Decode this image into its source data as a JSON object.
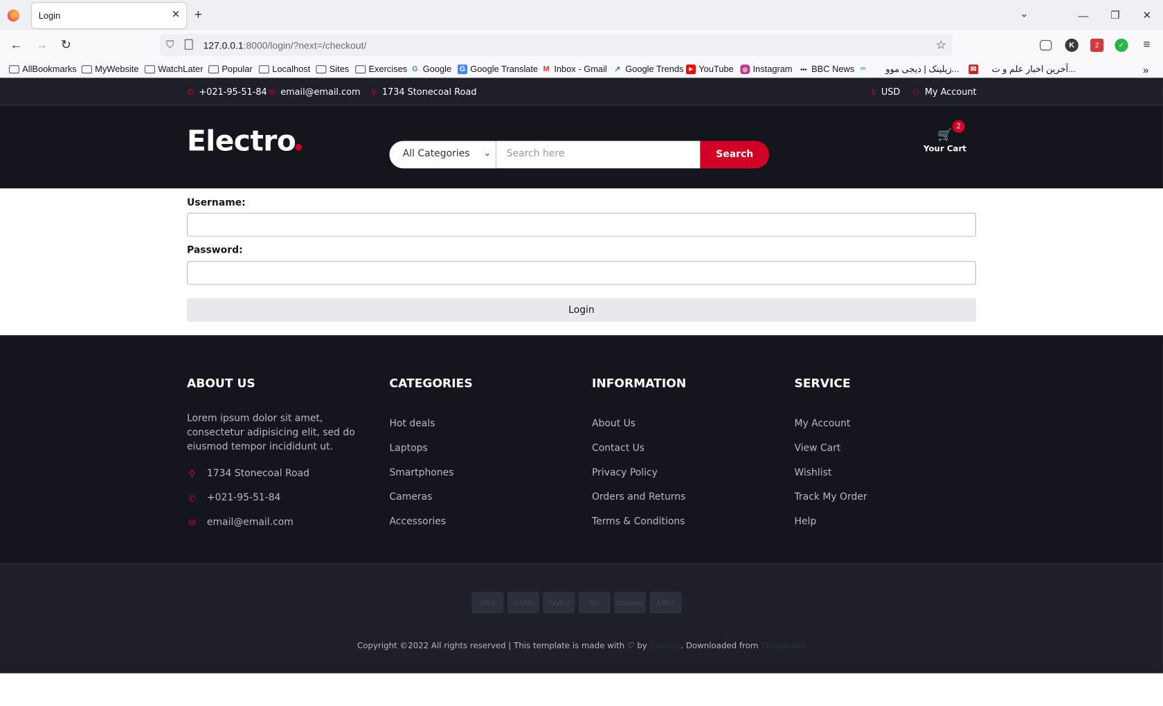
{
  "browser": {
    "tab_title": "Login",
    "url_host": "127.0.0.1",
    "url_rest": ":8000/login/?next=/checkout/",
    "bookmarks": [
      "AllBookmarks",
      "MyWebsite",
      "WatchLater",
      "Popular",
      "Localhost",
      "Sites",
      "Exercises",
      "Google",
      "Google Translate",
      "Inbox - Gmail",
      "Google Trends",
      "YouTube",
      "Instagram",
      "BBC News",
      "زیلینک | دیجی موو...",
      "آخرین اخبار علم و ت..."
    ],
    "ext_badge": "2"
  },
  "topbar": {
    "phone": "+021-95-51-84",
    "email": "email@email.com",
    "address": "1734 Stonecoal Road",
    "currency": "USD",
    "account": "My Account"
  },
  "header": {
    "logo": "Electro",
    "category_selected": "All Categories",
    "search_placeholder": "Search here",
    "search_button": "Search",
    "cart_label": "Your Cart",
    "cart_count": "2"
  },
  "form": {
    "username_label": "Username:",
    "password_label": "Password:",
    "login_button": "Login"
  },
  "footer": {
    "about_title": "ABOUT US",
    "about_text": "Lorem ipsum dolor sit amet, consectetur adipisicing elit, sed do eiusmod tempor incididunt ut.",
    "address": "1734 Stonecoal Road",
    "phone": "+021-95-51-84",
    "email": "email@email.com",
    "categories_title": "CATEGORIES",
    "categories": [
      "Hot deals",
      "Laptops",
      "Smartphones",
      "Cameras",
      "Accessories"
    ],
    "information_title": "INFORMATION",
    "information": [
      "About Us",
      "Contact Us",
      "Privacy Policy",
      "Orders and Returns",
      "Terms & Conditions"
    ],
    "service_title": "SERVICE",
    "service": [
      "My Account",
      "View Cart",
      "Wishlist",
      "Track My Order",
      "Help"
    ],
    "payment_methods": [
      "VISA",
      "CARD",
      "PayPal",
      "MC",
      "discover",
      "AMEX"
    ],
    "copyright_pre": "Copyright ©2022 All rights reserved | This template is made with",
    "copyright_by": "by",
    "copyright_colorlib": "Colorlib",
    "copyright_download": ". Downloaded from",
    "copyright_themeslab": "Themeslab"
  },
  "colors": {
    "accent": "#d10024",
    "dark": "#15161d",
    "topbar": "#1e1f29"
  }
}
